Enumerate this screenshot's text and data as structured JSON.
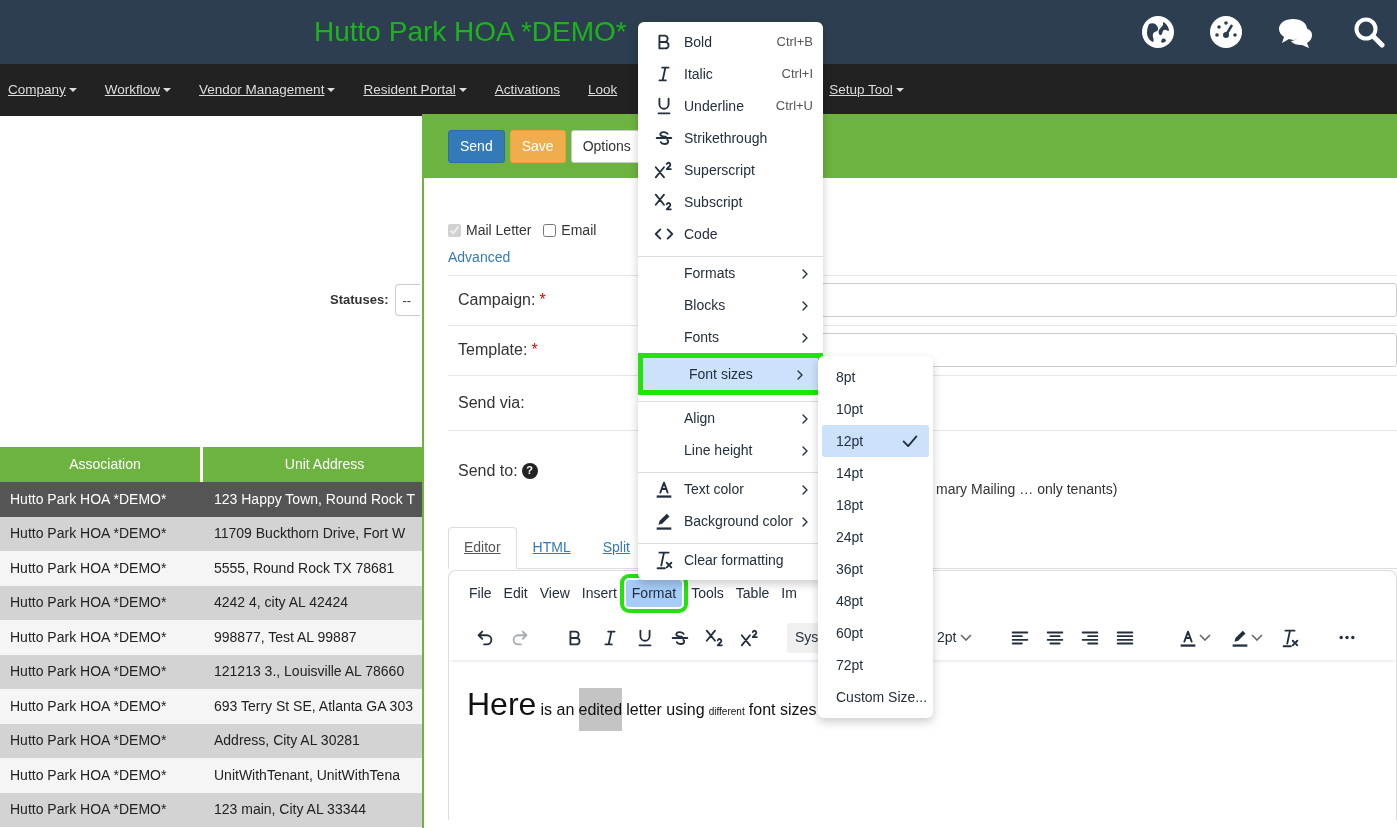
{
  "header": {
    "title": "Hutto Park HOA *DEMO*"
  },
  "nav": [
    {
      "label": "Company",
      "dropdown": true
    },
    {
      "label": "Workflow",
      "dropdown": true
    },
    {
      "label": "Vendor Management",
      "dropdown": true
    },
    {
      "label": "Resident Portal",
      "dropdown": true
    },
    {
      "label": "Activations",
      "dropdown": false
    },
    {
      "label": "Look",
      "dropdown": false
    },
    {
      "label": "Setup Tool",
      "dropdown": true
    }
  ],
  "filters": {
    "statuses_label": "Statuses:",
    "statuses_value": "--"
  },
  "table": {
    "columns": [
      "Association",
      "Unit Address"
    ],
    "rows": [
      {
        "cells": [
          "Hutto Park HOA *DEMO*",
          "123 Happy Town, Round Rock T"
        ],
        "selected": true
      },
      {
        "cells": [
          "Hutto Park HOA *DEMO*",
          "11709 Buckthorn Drive, Fort W"
        ],
        "selected": false
      },
      {
        "cells": [
          "Hutto Park HOA *DEMO*",
          "5555, Round Rock TX 78681"
        ],
        "selected": false
      },
      {
        "cells": [
          "Hutto Park HOA *DEMO*",
          "4242 4, city AL 42424"
        ],
        "selected": false
      },
      {
        "cells": [
          "Hutto Park HOA *DEMO*",
          "998877, Test AL 99887"
        ],
        "selected": false
      },
      {
        "cells": [
          "Hutto Park HOA *DEMO*",
          "121213 3., Louisville AL 78660"
        ],
        "selected": false
      },
      {
        "cells": [
          "Hutto Park HOA *DEMO*",
          "693 Terry St SE, Atlanta GA 303"
        ],
        "selected": false
      },
      {
        "cells": [
          "Hutto Park HOA *DEMO*",
          "Address, City AL 30281"
        ],
        "selected": false
      },
      {
        "cells": [
          "Hutto Park HOA *DEMO*",
          "UnitWithTenant, UnitWithTena"
        ],
        "selected": false
      },
      {
        "cells": [
          "Hutto Park HOA *DEMO*",
          "123 main, City AL 33344"
        ],
        "selected": false
      }
    ]
  },
  "dialog": {
    "buttons": [
      {
        "label": "Send",
        "kind": "primary"
      },
      {
        "label": "Save",
        "kind": "warning"
      },
      {
        "label": "Options",
        "kind": "default"
      }
    ],
    "delivery": [
      {
        "label": "Mail Letter",
        "checked": true,
        "disabled": true
      },
      {
        "label": "Email",
        "checked": false,
        "disabled": false
      }
    ],
    "advanced_link": "Advanced",
    "fields": [
      {
        "label": "Campaign:",
        "required_mark": "*",
        "kind": "input"
      },
      {
        "label": "Template:",
        "required_mark": "*",
        "kind": "input"
      },
      {
        "label": "Send via:",
        "kind": "blank"
      },
      {
        "label": "Send to:",
        "help": "?",
        "kind": "text",
        "text": "mary Mailing … only tenants)"
      }
    ],
    "tabs": [
      {
        "label": "Editor",
        "selected": true
      },
      {
        "label": "HTML",
        "selected": false
      },
      {
        "label": "Split",
        "selected": false
      }
    ],
    "editor": {
      "menubar": [
        {
          "label": "File",
          "selected": false,
          "outlined": false
        },
        {
          "label": "Edit",
          "selected": false,
          "outlined": false
        },
        {
          "label": "View",
          "selected": false,
          "outlined": false
        },
        {
          "label": "Insert",
          "selected": false,
          "outlined": false
        },
        {
          "label": "Format",
          "selected": true,
          "outlined": true
        },
        {
          "label": "Tools",
          "selected": false,
          "outlined": false
        },
        {
          "label": "Table",
          "selected": false,
          "outlined": false
        },
        {
          "label": "Im",
          "selected": false,
          "outlined": false
        }
      ],
      "tools": [
        {
          "disabled": false
        },
        {
          "disabled": true
        },
        {
          "disabled": false
        },
        {
          "disabled": false
        },
        {
          "disabled": false
        },
        {
          "disabled": false
        },
        {
          "disabled": false
        },
        {
          "disabled": false
        },
        {
          "disabled": false
        },
        {
          "disabled": false
        },
        {
          "disabled": false
        },
        {
          "disabled": false
        },
        {
          "disabled": false
        },
        {
          "disabled": false
        },
        {
          "disabled": false
        },
        {
          "disabled": false
        }
      ],
      "font_family": "Sys",
      "font_size": "2pt",
      "content": [
        {
          "text": "Here",
          "kind": "large",
          "highlight": false
        },
        {
          "text": "is an",
          "kind": "normal",
          "highlight": false
        },
        {
          "text": "edited",
          "kind": "normal",
          "highlight": true
        },
        {
          "text": "letter using",
          "kind": "normal",
          "highlight": false
        },
        {
          "text": "different",
          "kind": "tiny",
          "highlight": false
        },
        {
          "text": "font sizes",
          "kind": "normal",
          "highlight": false
        }
      ]
    }
  },
  "format_menu": [
    {
      "label": "Bold",
      "shortcut": "Ctrl+B",
      "submenu": false,
      "selected": false,
      "outlined": false,
      "divider_before": false
    },
    {
      "label": "Italic",
      "shortcut": "Ctrl+I",
      "submenu": false,
      "selected": false,
      "outlined": false,
      "divider_before": false
    },
    {
      "label": "Underline",
      "shortcut": "Ctrl+U",
      "submenu": false,
      "selected": false,
      "outlined": false,
      "divider_before": false
    },
    {
      "label": "Strikethrough",
      "submenu": false,
      "selected": false,
      "outlined": false,
      "divider_before": false
    },
    {
      "label": "Superscript",
      "submenu": false,
      "selected": false,
      "outlined": false,
      "divider_before": false
    },
    {
      "label": "Subscript",
      "submenu": false,
      "selected": false,
      "outlined": false,
      "divider_before": false
    },
    {
      "label": "Code",
      "submenu": false,
      "selected": false,
      "outlined": false,
      "divider_before": false
    },
    {
      "label": "Formats",
      "submenu": true,
      "selected": false,
      "outlined": false,
      "divider_before": true
    },
    {
      "label": "Blocks",
      "submenu": true,
      "selected": false,
      "outlined": false,
      "divider_before": false
    },
    {
      "label": "Fonts",
      "submenu": true,
      "selected": false,
      "outlined": false,
      "divider_before": false
    },
    {
      "label": "Font sizes",
      "submenu": true,
      "selected": true,
      "outlined": true,
      "divider_before": false
    },
    {
      "label": "Align",
      "submenu": true,
      "selected": false,
      "outlined": false,
      "divider_before": true
    },
    {
      "label": "Line height",
      "submenu": true,
      "selected": false,
      "outlined": false,
      "divider_before": false
    },
    {
      "label": "Text color",
      "submenu": true,
      "selected": false,
      "outlined": false,
      "divider_before": true
    },
    {
      "label": "Background color",
      "submenu": true,
      "selected": false,
      "outlined": false,
      "divider_before": false
    },
    {
      "label": "Clear formatting",
      "submenu": false,
      "selected": false,
      "outlined": false,
      "divider_before": true
    }
  ],
  "font_size_menu": [
    {
      "label": "8pt",
      "selected": false
    },
    {
      "label": "10pt",
      "selected": false
    },
    {
      "label": "12pt",
      "selected": true
    },
    {
      "label": "14pt",
      "selected": false
    },
    {
      "label": "18pt",
      "selected": false
    },
    {
      "label": "24pt",
      "selected": false
    },
    {
      "label": "36pt",
      "selected": false
    },
    {
      "label": "48pt",
      "selected": false
    },
    {
      "label": "60pt",
      "selected": false
    },
    {
      "label": "72pt",
      "selected": false
    },
    {
      "label": "Custom Size...",
      "selected": false
    }
  ]
}
